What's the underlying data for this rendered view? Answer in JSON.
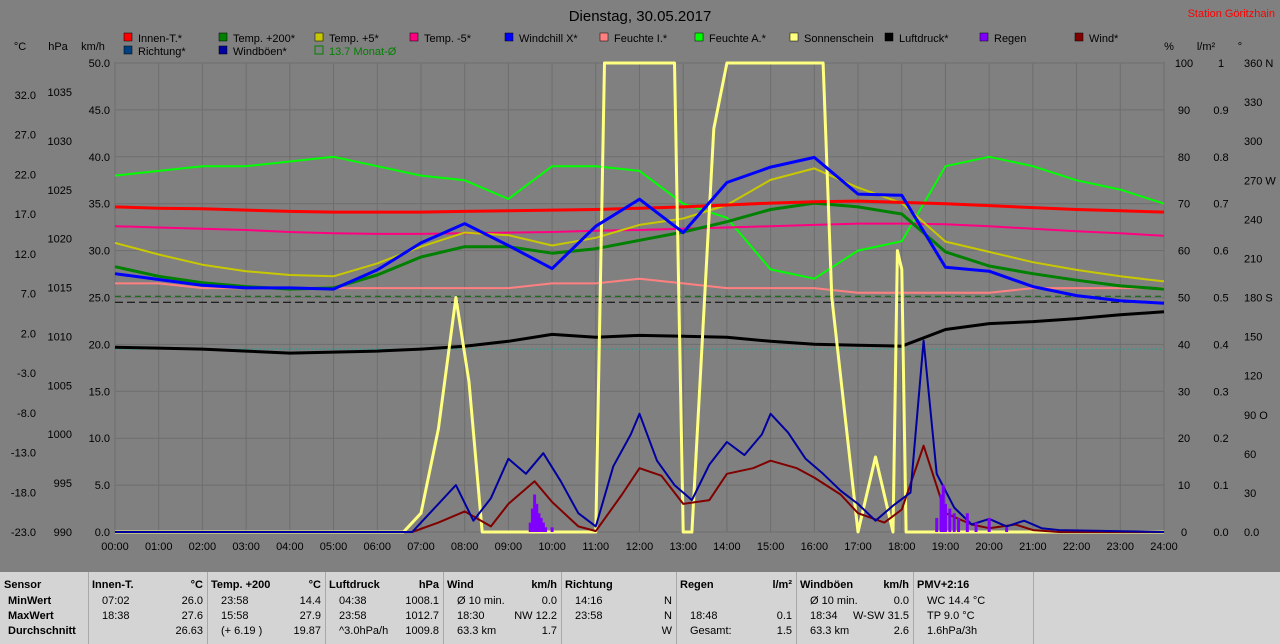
{
  "chart_data": {
    "type": "line",
    "title": "Dienstag, 30.05.2017",
    "station": "Station Göritzhain",
    "legend": [
      {
        "name": "Innen-T.*",
        "color": "#ff0000"
      },
      {
        "name": "Temp. +200*",
        "color": "#008000"
      },
      {
        "name": "Temp. +5*",
        "color": "#c8c800"
      },
      {
        "name": "Temp. -5*",
        "color": "#ff0080"
      },
      {
        "name": "Windchill X*",
        "color": "#0000ff"
      },
      {
        "name": "Feuchte I.*",
        "color": "#ff8080"
      },
      {
        "name": "Feuchte A.*",
        "color": "#00ff00"
      },
      {
        "name": "Sonnenschein",
        "color": "#ffff80"
      },
      {
        "name": "Luftdruck*",
        "color": "#000000"
      },
      {
        "name": "Regen",
        "color": "#8000ff"
      },
      {
        "name": "Wind*",
        "color": "#800000"
      },
      {
        "name": "Richtung*",
        "color": "#004080"
      },
      {
        "name": "Windböen*",
        "color": "#0000a0"
      },
      {
        "name": "13.7 Monat-Ø",
        "color": "#008000"
      }
    ],
    "axes": {
      "temp": {
        "label": "°C",
        "ticks": [
          "32.0",
          "27.0",
          "22.0",
          "17.0",
          "12.0",
          "7.0",
          "2.0",
          "-3.0",
          "-8.0",
          "-13.0",
          "-18.0",
          "-23.0"
        ],
        "range": [
          -23,
          50
        ]
      },
      "pressure": {
        "label": "hPa",
        "ticks": [
          "1035",
          "1030",
          "1025",
          "1020",
          "1015",
          "1010",
          "1005",
          "1000",
          "995",
          "990"
        ],
        "range": [
          990,
          1037.7
        ]
      },
      "wind": {
        "label": "km/h",
        "ticks": [
          "50.0",
          "45.0",
          "40.0",
          "35.0",
          "30.0",
          "25.0",
          "20.0",
          "15.0",
          "10.0",
          "5.0",
          "0.0"
        ],
        "range": [
          0,
          50
        ]
      },
      "humidity": {
        "label": "%",
        "ticks": [
          "100",
          "90",
          "80",
          "70",
          "60",
          "50",
          "40",
          "30",
          "20",
          "10",
          "0"
        ],
        "range": [
          0,
          100
        ]
      },
      "rain": {
        "label": "l/m²",
        "ticks": [
          "1",
          "0.9",
          "0.8",
          "0.7",
          "0.6",
          "0.5",
          "0.4",
          "0.3",
          "0.2",
          "0.1",
          "0.0"
        ],
        "range": [
          0,
          1
        ]
      },
      "direction": {
        "label": "°",
        "ticks": [
          "360 N",
          "330",
          "300",
          "270 W",
          "240",
          "210",
          "180 S",
          "150",
          "120",
          "90 O",
          "60",
          "30",
          "0.0"
        ],
        "range": [
          0,
          360
        ]
      },
      "x": {
        "ticks": [
          "00:00",
          "01:00",
          "02:00",
          "03:00",
          "04:00",
          "05:00",
          "06:00",
          "07:00",
          "08:00",
          "09:00",
          "10:00",
          "11:00",
          "12:00",
          "13:00",
          "14:00",
          "15:00",
          "16:00",
          "17:00",
          "18:00",
          "19:00",
          "20:00",
          "21:00",
          "22:00",
          "23:00",
          "24:00"
        ],
        "range": [
          0,
          24
        ]
      }
    },
    "reference_lines": [
      {
        "name": "13.7 Monat-Ø",
        "axis": "temp",
        "value": 13.7
      },
      {
        "axis": "humidity",
        "value": 49
      },
      {
        "axis": "humidity",
        "value": 39
      }
    ],
    "series": [
      {
        "name": "Innen-T.*",
        "axis": "temp",
        "x": [
          0,
          1,
          2,
          3,
          4,
          5,
          6,
          7,
          8,
          9,
          10,
          11,
          12,
          13,
          14,
          15,
          16,
          17,
          18,
          19,
          20,
          21,
          22,
          23,
          24
        ],
        "y": [
          27.6,
          27.4,
          27.3,
          27.1,
          26.9,
          26.8,
          26.8,
          26.8,
          26.9,
          27.0,
          27.1,
          27.2,
          27.4,
          27.6,
          27.9,
          28.2,
          28.4,
          28.5,
          28.3,
          28.1,
          27.8,
          27.5,
          27.2,
          27.0,
          26.8
        ]
      },
      {
        "name": "Temp. +200*",
        "axis": "temp",
        "x": [
          0,
          1,
          2,
          3,
          4,
          5,
          6,
          7,
          8,
          9,
          10,
          11,
          12,
          13,
          14,
          15,
          16,
          17,
          18,
          19,
          20,
          21,
          22,
          23,
          24
        ],
        "y": [
          18.3,
          16.8,
          15.8,
          15.2,
          14.8,
          15.0,
          17.0,
          19.8,
          21.4,
          21.4,
          20.4,
          21.1,
          22.4,
          23.7,
          25.3,
          27.2,
          28.2,
          27.6,
          26.5,
          20.6,
          18.4,
          17.2,
          16.2,
          15.3,
          14.8
        ]
      },
      {
        "name": "Temp. +5*",
        "axis": "temp",
        "x": [
          0,
          1,
          2,
          3,
          4,
          5,
          6,
          7,
          8,
          9,
          10,
          11,
          12,
          13,
          14,
          15,
          16,
          17,
          18,
          19,
          20,
          21,
          22,
          23,
          24
        ],
        "y": [
          22.0,
          20.2,
          18.6,
          17.6,
          17.0,
          16.8,
          18.8,
          21.4,
          23.6,
          23.2,
          21.6,
          22.8,
          24.8,
          25.8,
          27.9,
          31.8,
          33.6,
          30.6,
          28.2,
          22.2,
          20.6,
          19.0,
          17.8,
          16.8,
          16.0
        ]
      },
      {
        "name": "Temp. -5*",
        "axis": "temp",
        "x": [
          0,
          1,
          2,
          3,
          4,
          5,
          6,
          7,
          8,
          9,
          10,
          11,
          12,
          13,
          14,
          15,
          16,
          17,
          18,
          19,
          20,
          21,
          22,
          23,
          24
        ],
        "y": [
          24.6,
          24.4,
          24.2,
          24.0,
          23.7,
          23.5,
          23.4,
          23.4,
          23.5,
          23.6,
          23.7,
          23.9,
          24.0,
          24.2,
          24.4,
          24.6,
          24.8,
          25.0,
          25.0,
          24.9,
          24.6,
          24.2,
          23.8,
          23.5,
          23.1
        ]
      },
      {
        "name": "Windchill X*",
        "axis": "temp",
        "x": [
          0,
          1,
          2,
          3,
          4,
          5,
          6,
          7,
          8,
          9,
          10,
          11,
          12,
          13,
          14,
          15,
          16,
          17,
          18,
          19,
          20,
          21,
          22,
          23,
          24
        ],
        "y": [
          17.2,
          16.3,
          15.4,
          15.0,
          15.0,
          14.8,
          17.8,
          22.0,
          25.0,
          21.6,
          18.0,
          24.6,
          28.8,
          23.6,
          31.4,
          33.8,
          35.3,
          29.6,
          29.4,
          18.2,
          17.6,
          15.2,
          13.8,
          13.0,
          12.6
        ]
      },
      {
        "name": "Feuchte I.*",
        "axis": "humidity",
        "x": [
          0,
          1,
          2,
          3,
          4,
          5,
          6,
          7,
          8,
          9,
          10,
          11,
          12,
          13,
          14,
          15,
          16,
          17,
          18,
          19,
          20,
          21,
          22,
          23,
          24
        ],
        "y": [
          53,
          53,
          52,
          52,
          52,
          52,
          52,
          52,
          52,
          52,
          53,
          53,
          54,
          53,
          52,
          52,
          52,
          51,
          51,
          51,
          51,
          52,
          52,
          52,
          52
        ]
      },
      {
        "name": "Feuchte A.*",
        "axis": "humidity",
        "x": [
          0,
          1,
          2,
          3,
          4,
          5,
          6,
          7,
          8,
          9,
          10,
          11,
          12,
          13,
          14,
          15,
          16,
          17,
          18,
          19,
          20,
          21,
          22,
          23,
          24
        ],
        "y": [
          76,
          77,
          78,
          78,
          79,
          80,
          78,
          76,
          75,
          71,
          78,
          78,
          77,
          70,
          67,
          56,
          54,
          60,
          62,
          78,
          80,
          78,
          75,
          73,
          70
        ]
      },
      {
        "name": "Luftdruck*",
        "axis": "pressure",
        "x": [
          0,
          1,
          2,
          3,
          4,
          5,
          6,
          7,
          8,
          9,
          10,
          11,
          12,
          13,
          14,
          15,
          16,
          17,
          18,
          19,
          20,
          21,
          22,
          23,
          24
        ],
        "y": [
          1008.8,
          1008.7,
          1008.6,
          1008.4,
          1008.2,
          1008.3,
          1008.4,
          1008.6,
          1008.9,
          1009.4,
          1010.1,
          1009.8,
          1010.0,
          1009.9,
          1009.8,
          1009.4,
          1009.1,
          1009.0,
          1008.9,
          1010.6,
          1011.2,
          1011.4,
          1011.7,
          1012.1,
          1012.4
        ]
      },
      {
        "name": "Sonnenschein",
        "axis": "wind",
        "x": [
          0,
          6.6,
          7.0,
          7.4,
          7.8,
          8.1,
          8.4,
          8.6,
          11.0,
          11.2,
          12.8,
          13.0,
          13.2,
          13.7,
          14.0,
          16.2,
          16.4,
          17.0,
          17.4,
          17.8,
          17.9,
          18.0,
          18.1,
          24
        ],
        "y": [
          0,
          0,
          2,
          11,
          25,
          16,
          0,
          0,
          0,
          50,
          50,
          0,
          0,
          43,
          50,
          50,
          25,
          0,
          8,
          0,
          30,
          28,
          0,
          0
        ]
      },
      {
        "name": "Wind*",
        "axis": "wind",
        "x": [
          0,
          6.8,
          7.4,
          8.0,
          8.6,
          9.0,
          9.6,
          10.0,
          10.6,
          11.0,
          11.6,
          12.0,
          12.5,
          13.0,
          13.6,
          14.0,
          14.6,
          15.0,
          15.6,
          16.0,
          16.6,
          17.0,
          17.6,
          18.0,
          18.5,
          19.0,
          19.6,
          20.0,
          20.6,
          21.0,
          21.6,
          24
        ],
        "y": [
          0,
          0,
          1.0,
          2.2,
          0.6,
          3.0,
          5.4,
          3.2,
          0.6,
          0.1,
          4.0,
          6.8,
          6.0,
          3.0,
          3.4,
          6.2,
          6.8,
          7.6,
          6.8,
          5.8,
          4.0,
          2.0,
          1.0,
          2.4,
          9.2,
          2.0,
          0.8,
          0.4,
          0.8,
          0.2,
          0,
          0
        ]
      },
      {
        "name": "Windböen*",
        "axis": "wind",
        "x": [
          0,
          6.8,
          7.4,
          7.8,
          8.2,
          8.6,
          9.0,
          9.4,
          9.8,
          10.2,
          10.6,
          11.0,
          11.4,
          11.8,
          12.0,
          12.4,
          12.8,
          13.2,
          13.6,
          14.0,
          14.4,
          14.8,
          15.0,
          15.4,
          15.8,
          16.2,
          16.6,
          17.0,
          17.4,
          17.8,
          18.2,
          18.5,
          18.8,
          19.2,
          19.6,
          20.0,
          20.4,
          20.8,
          21.2,
          21.6,
          24
        ],
        "y": [
          0,
          0,
          3.0,
          5.0,
          1.2,
          3.6,
          7.8,
          6.2,
          8.4,
          5.4,
          2.0,
          0.6,
          7.0,
          10.4,
          12.6,
          7.6,
          5.0,
          3.4,
          7.2,
          9.6,
          8.2,
          10.4,
          12.6,
          10.6,
          7.8,
          6.2,
          4.4,
          3.0,
          1.2,
          2.8,
          4.2,
          20.4,
          6.2,
          2.6,
          0.8,
          1.4,
          0.6,
          1.2,
          0.4,
          0.2,
          0
        ]
      },
      {
        "name": "Regen",
        "axis": "rain",
        "x": [
          9.5,
          9.55,
          9.6,
          9.65,
          9.7,
          9.75,
          9.8,
          9.85,
          10.0,
          18.8,
          18.9,
          18.95,
          19.0,
          19.1,
          19.2,
          19.3,
          19.5,
          19.7,
          20.0,
          20.4
        ],
        "y": [
          0.02,
          0.05,
          0.08,
          0.06,
          0.04,
          0.03,
          0.02,
          0.01,
          0.01,
          0.03,
          0.08,
          0.1,
          0.06,
          0.05,
          0.04,
          0.03,
          0.04,
          0.02,
          0.03,
          0.01
        ]
      }
    ]
  },
  "stats": {
    "columns": [
      {
        "header": "Sensor",
        "unit": "",
        "rows": [
          [
            "MinWert",
            "",
            ""
          ],
          [
            "MaxWert",
            "",
            ""
          ],
          [
            "Durchschnitt",
            "",
            ""
          ]
        ]
      },
      {
        "header": "Innen-T.",
        "unit": "°C",
        "rows": [
          [
            "07:02",
            "",
            "26.0"
          ],
          [
            "18:38",
            "",
            "27.6"
          ],
          [
            "",
            "",
            "26.63"
          ]
        ]
      },
      {
        "header": "Temp. +200",
        "unit": "°C",
        "rows": [
          [
            "23:58",
            "",
            "14.4"
          ],
          [
            "15:58",
            "",
            "27.9"
          ],
          [
            "(+ 6.19 )",
            "",
            "19.87"
          ]
        ]
      },
      {
        "header": "Luftdruck",
        "unit": "hPa",
        "rows": [
          [
            "04:38",
            "",
            "1008.1"
          ],
          [
            "23:58",
            "",
            "1012.7"
          ],
          [
            "^3.0hPa/h",
            "",
            "1009.8"
          ]
        ]
      },
      {
        "header": "Wind",
        "unit": "km/h",
        "rows": [
          [
            "Ø 10 min.",
            "",
            "0.0"
          ],
          [
            "18:30",
            "NW 12.2",
            ""
          ],
          [
            "63.3 km",
            "",
            "1.7"
          ]
        ]
      },
      {
        "header": "Richtung",
        "unit": "",
        "rows": [
          [
            "14:16",
            "",
            "N"
          ],
          [
            "23:58",
            "",
            "N"
          ],
          [
            "",
            "",
            "W"
          ]
        ]
      },
      {
        "header": "Regen",
        "unit": "l/m²",
        "rows": [
          [
            "",
            "",
            ""
          ],
          [
            "18:48",
            "",
            "0.1"
          ],
          [
            "Gesamt:",
            "",
            "1.5"
          ]
        ]
      },
      {
        "header": "Windböen",
        "unit": "km/h",
        "rows": [
          [
            "Ø 10 min.",
            "",
            "0.0"
          ],
          [
            "18:34",
            "W-SW 31.5",
            ""
          ],
          [
            "63.3 km",
            "",
            "2.6"
          ]
        ]
      },
      {
        "header": "PMV+2:16",
        "unit": "",
        "rows": [
          [
            "WC 14.4 °C",
            "",
            ""
          ],
          [
            "TP 9.0 °C",
            "",
            ""
          ],
          [
            "1.6hPa/3h",
            "",
            ""
          ]
        ]
      }
    ]
  }
}
